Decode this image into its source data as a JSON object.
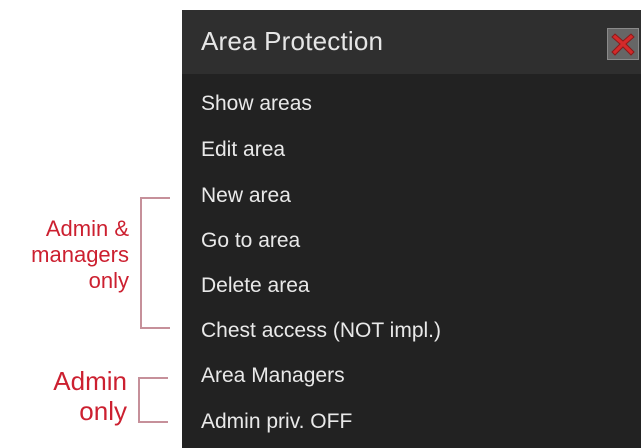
{
  "window": {
    "title": "Area Protection",
    "close_icon": "close-x-icon"
  },
  "menu": {
    "items": [
      {
        "label": "Show areas"
      },
      {
        "label": "Edit area"
      },
      {
        "label": "New area"
      },
      {
        "label": "Go to area"
      },
      {
        "label": "Delete area"
      },
      {
        "label": "Chest access (NOT impl.)"
      },
      {
        "label": "Area Managers"
      },
      {
        "label": "Admin priv. OFF"
      }
    ]
  },
  "annotations": {
    "group1": {
      "lines": [
        "Admin &",
        "managers",
        "only"
      ]
    },
    "group2": {
      "lines": [
        "Admin",
        "only"
      ]
    }
  },
  "colors": {
    "panel_bg": "#222222",
    "titlebar_bg": "#2f2f2f",
    "menu_text": "#e9e9e9",
    "annotation_red": "#cc2030",
    "close_x_red": "#d42a2a"
  }
}
